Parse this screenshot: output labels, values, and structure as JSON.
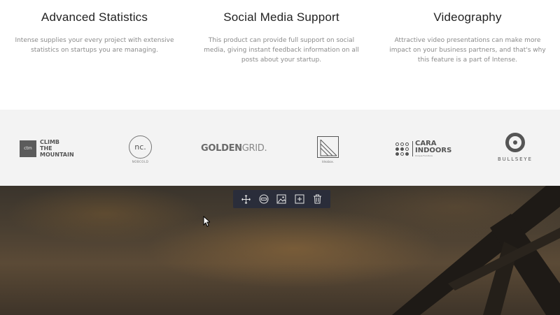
{
  "features": [
    {
      "title": "Advanced Statistics",
      "text": "Intense supplies your every project with extensive statistics on startups you are managing."
    },
    {
      "title": "Social Media Support",
      "text": "This product can provide full support on social media, giving instant feedback information on all posts about your startup."
    },
    {
      "title": "Videography",
      "text": "Attractive video presentations can make more impact on your business partners, and that's why this feature is a part of Intense."
    }
  ],
  "clients": {
    "ctm": {
      "badge": "ctm",
      "line1": "CLIMB",
      "line2": "THE",
      "line3": "MOUNTAIN"
    },
    "nc": {
      "mark": "nc.",
      "sub": "NOBCOLD"
    },
    "golden": {
      "bold": "GOLDEN",
      "light": "GRID."
    },
    "ideabox": {
      "sub": "Ideabox."
    },
    "cara": {
      "line1": "CARA",
      "line2": "INDOORS",
      "sub": "Unique Furniture"
    },
    "bullseye": {
      "name": "BULLSEYE"
    }
  },
  "toolbar": {
    "icons": [
      "move-icon",
      "link-icon",
      "image-icon",
      "add-icon",
      "trash-icon"
    ]
  },
  "colors": {
    "toolbar_bg": "#2a2d3a",
    "strip_bg": "#f3f3f3",
    "logo_gray": "#555555"
  }
}
